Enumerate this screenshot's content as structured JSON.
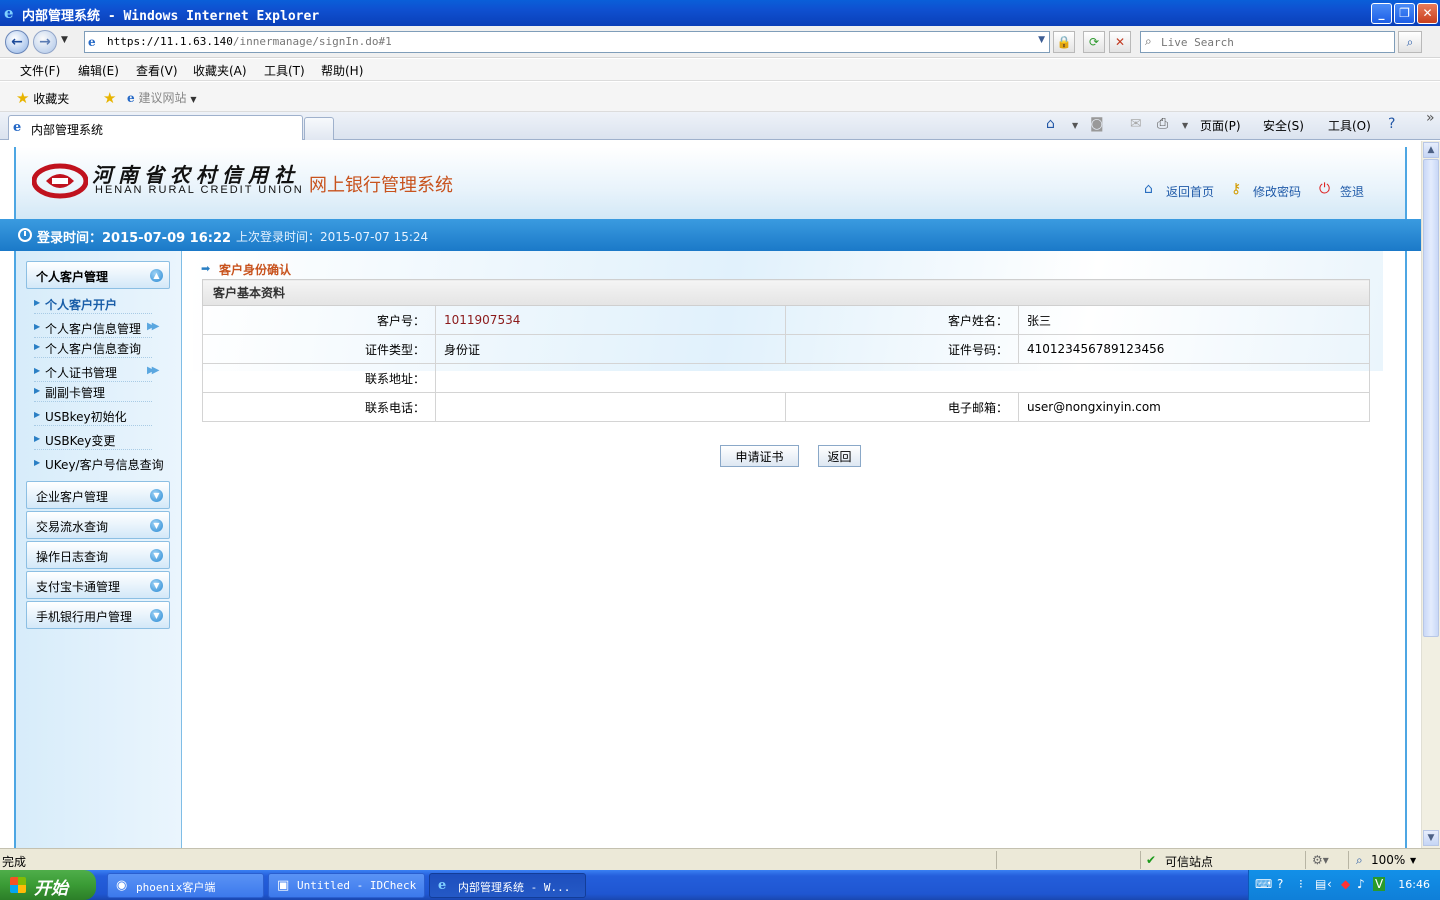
{
  "window": {
    "title": "内部管理系统 - Windows Internet Explorer",
    "url_host": "https://11.1.63.140",
    "url_path": "/innermanage/signIn.do#1",
    "search_placeholder": "Live Search"
  },
  "menu": [
    "文件(F)",
    "编辑(E)",
    "查看(V)",
    "收藏夹(A)",
    "工具(T)",
    "帮助(H)"
  ],
  "favorites": {
    "label": "收藏夹",
    "suggested": "建议网站"
  },
  "tab": {
    "label": "内部管理系统"
  },
  "commandbar": {
    "page": "页面(P)",
    "safety": "安全(S)",
    "tools": "工具(O)"
  },
  "header": {
    "logo_cn": "河南省农村信用社",
    "logo_en": "HENAN  RURAL  CREDIT  UNION",
    "system_name": "网上银行管理系统",
    "links": {
      "home": "返回首页",
      "password": "修改密码",
      "logout": "签退"
    }
  },
  "infobar": {
    "login_time": "登录时间：2015-07-09 16:22",
    "last_login": "上次登录时间：2015-07-07 15:24"
  },
  "sidebar": {
    "personal": {
      "label": "个人客户管理",
      "items": [
        {
          "label": "个人客户开户"
        },
        {
          "label": "个人客户信息管理"
        },
        {
          "label": "个人客户信息查询"
        },
        {
          "label": "个人证书管理"
        },
        {
          "label": "副副卡管理"
        },
        {
          "label": "USBkey初始化"
        },
        {
          "label": "USBKey变更"
        },
        {
          "label": "UKey/客户号信息查询"
        }
      ]
    },
    "groups": [
      {
        "label": "企业客户管理"
      },
      {
        "label": "交易流水查询"
      },
      {
        "label": "操作日志查询"
      },
      {
        "label": "支付宝卡通管理"
      },
      {
        "label": "手机银行用户管理"
      }
    ]
  },
  "content": {
    "breadcrumb": "客户身份确认",
    "section_title": "客户基本资料",
    "fields": {
      "customer_no_label": "客户号：",
      "customer_no": "1011907534",
      "customer_name_label": "客户姓名：",
      "customer_name": "张三",
      "id_type_label": "证件类型：",
      "id_type": "身份证",
      "id_no_label": "证件号码：",
      "id_no": "410123456789123456",
      "address_label": "联系地址：",
      "address": "",
      "phone_label": "联系电话：",
      "phone": "",
      "email_label": "电子邮箱：",
      "email": "user@nongxinyin.com"
    },
    "buttons": {
      "apply": "申请证书",
      "back": "返回"
    }
  },
  "status": {
    "left": "完成",
    "zone": "可信站点",
    "zoom": "100%"
  },
  "taskbar": {
    "start": "开始",
    "tasks": [
      "phoenix客户端",
      "Untitled - IDCheck",
      "内部管理系统 - W..."
    ],
    "clock": "16:46"
  }
}
